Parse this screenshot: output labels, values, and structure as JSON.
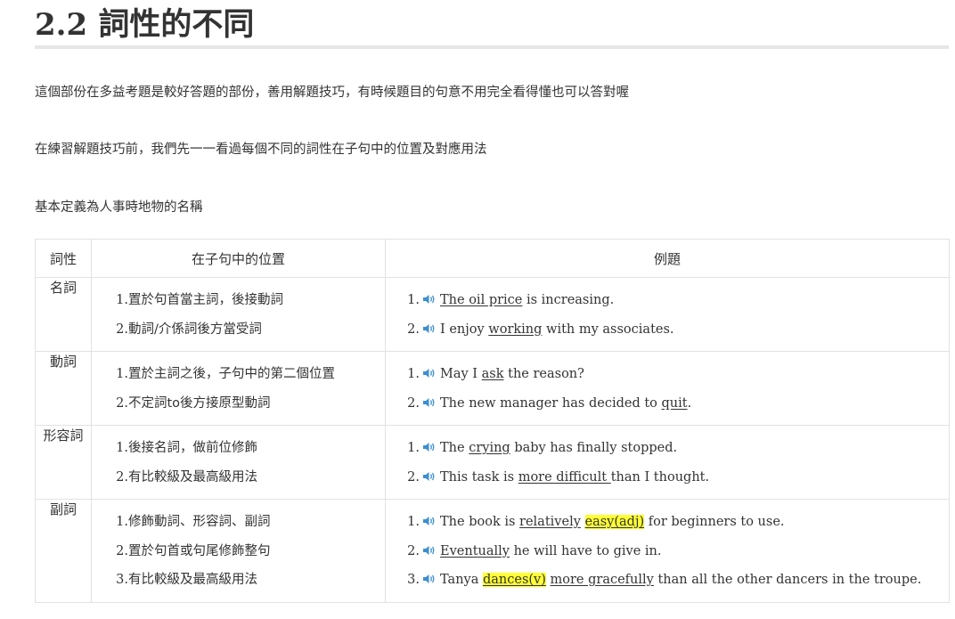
{
  "heading": {
    "number": "2.2",
    "title": "詞性的不同"
  },
  "paragraphs": [
    "這個部份在多益考題是較好答題的部份，善用解題技巧，有時候題目的句意不用完全看得懂也可以答對喔",
    "在練習解題技巧前，我們先一一看過每個不同的詞性在子句中的位置及對應用法",
    "基本定義為人事時地物的名稱"
  ],
  "table": {
    "headers": [
      "詞性",
      "在子句中的位置",
      "例題"
    ],
    "rows": [
      {
        "pos": "名詞",
        "positions": [
          "置於句首當主詞，後接動詞",
          "動詞/介係詞後方當受詞"
        ],
        "examples": [
          [
            {
              "t": "The oil price",
              "u": true
            },
            {
              "t": " is increasing."
            }
          ],
          [
            {
              "t": "I enjoy "
            },
            {
              "t": "working",
              "u": true
            },
            {
              "t": " with my associates."
            }
          ]
        ]
      },
      {
        "pos": "動詞",
        "positions": [
          "置於主詞之後，子句中的第二個位置",
          "不定詞to後方接原型動詞"
        ],
        "examples": [
          [
            {
              "t": "May I "
            },
            {
              "t": "ask",
              "u": true
            },
            {
              "t": " the reason?"
            }
          ],
          [
            {
              "t": "The new manager has decided to "
            },
            {
              "t": "quit",
              "u": true
            },
            {
              "t": "."
            }
          ]
        ]
      },
      {
        "pos": "形容詞",
        "positions": [
          "後接名詞，做前位修飾",
          "有比較級及最高級用法"
        ],
        "examples": [
          [
            {
              "t": "The "
            },
            {
              "t": "crying",
              "u": true
            },
            {
              "t": " baby has finally stopped."
            }
          ],
          [
            {
              "t": "This task is "
            },
            {
              "t": "more difficult ",
              "u": true
            },
            {
              "t": "than I thought."
            }
          ]
        ]
      },
      {
        "pos": "副詞",
        "positions": [
          "修飾動詞、形容詞、副詞",
          "置於句首或句尾修飾整句",
          "有比較級及最高級用法"
        ],
        "examples": [
          [
            {
              "t": "The book is "
            },
            {
              "t": "relatively",
              "u": true
            },
            {
              "t": " "
            },
            {
              "t": "easy(adj)",
              "u": true,
              "hl": true
            },
            {
              "t": " for beginners to use."
            }
          ],
          [
            {
              "t": "Eventually",
              "u": true
            },
            {
              "t": " he will have to give in."
            }
          ],
          [
            {
              "t": "Tanya "
            },
            {
              "t": "dances(v)",
              "u": true,
              "hl": true
            },
            {
              "t": " "
            },
            {
              "t": "more gracefully",
              "u": true
            },
            {
              "t": " than all the other dancers in the troupe."
            }
          ]
        ]
      }
    ]
  },
  "icons": {
    "audio": "speaker-icon"
  },
  "colors": {
    "text": "#333333",
    "highlight": "#ffff33",
    "rule": "#e6e6e6",
    "border": "#e2e2e2",
    "speaker": "#3d8fd1"
  }
}
